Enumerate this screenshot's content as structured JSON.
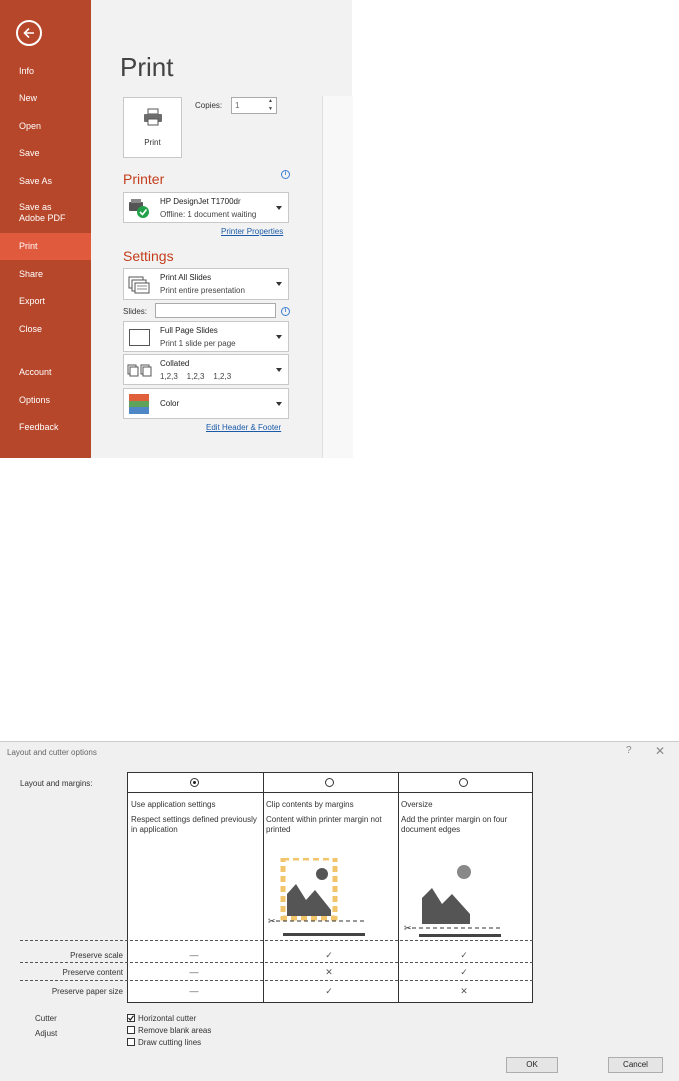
{
  "backstage": {
    "nav": [
      {
        "label": "Info"
      },
      {
        "label": "New"
      },
      {
        "label": "Open"
      },
      {
        "label": "Save"
      },
      {
        "label": "Save As"
      },
      {
        "label": "Save as Adobe PDF"
      },
      {
        "label": "Print",
        "active": true
      },
      {
        "label": "Share"
      },
      {
        "label": "Export"
      },
      {
        "label": "Close"
      },
      {
        "label": "Account"
      },
      {
        "label": "Options"
      },
      {
        "label": "Feedback"
      }
    ],
    "title": "Print",
    "print_button": "Print",
    "copies_label": "Copies:",
    "copies_value": "1",
    "printer_heading": "Printer",
    "printer_name": "HP DesignJet T1700dr",
    "printer_status": "Offline: 1 document waiting",
    "printer_properties": "Printer Properties",
    "settings_heading": "Settings",
    "slides_range": {
      "title": "Print All Slides",
      "sub": "Print entire presentation"
    },
    "slides_label": "Slides:",
    "slides_value": "",
    "layout": {
      "title": "Full Page Slides",
      "sub": "Print 1 slide per page"
    },
    "collation": {
      "title": "Collated",
      "sub": "1,2,3    1,2,3    1,2,3"
    },
    "color": {
      "title": "Color"
    },
    "edit_header_footer": "Edit Header & Footer",
    "colors": {
      "sidebar": "#b7472a",
      "active": "#e05a3e",
      "accent": "#c43e1c"
    }
  },
  "dialog": {
    "title": "Layout and cutter options",
    "help": "?",
    "close": "✕",
    "layout_label": "Layout and margins:",
    "options": [
      {
        "title": "Use application settings",
        "desc": "Respect settings defined previously in application",
        "selected": true
      },
      {
        "title": "Clip contents by margins",
        "desc": "Content within printer margin not printed",
        "selected": false
      },
      {
        "title": "Oversize",
        "desc": "Add the printer margin on four document edges",
        "selected": false
      }
    ],
    "rows": [
      {
        "label": "Preserve scale",
        "values": [
          "—",
          "✓",
          "✓"
        ]
      },
      {
        "label": "Preserve content",
        "values": [
          "—",
          "✕",
          "✓"
        ]
      },
      {
        "label": "Preserve paper size",
        "values": [
          "—",
          "✓",
          "✕"
        ]
      }
    ],
    "cutter_label": "Cutter",
    "adjust_label": "Adjust",
    "horizontal_cutter": {
      "label": "Horizontal cutter",
      "checked": true
    },
    "remove_blank": {
      "label": "Remove blank areas",
      "checked": false
    },
    "draw_cutting": {
      "label": "Draw cutting lines",
      "checked": false
    },
    "ok": "OK",
    "cancel": "Cancel"
  }
}
